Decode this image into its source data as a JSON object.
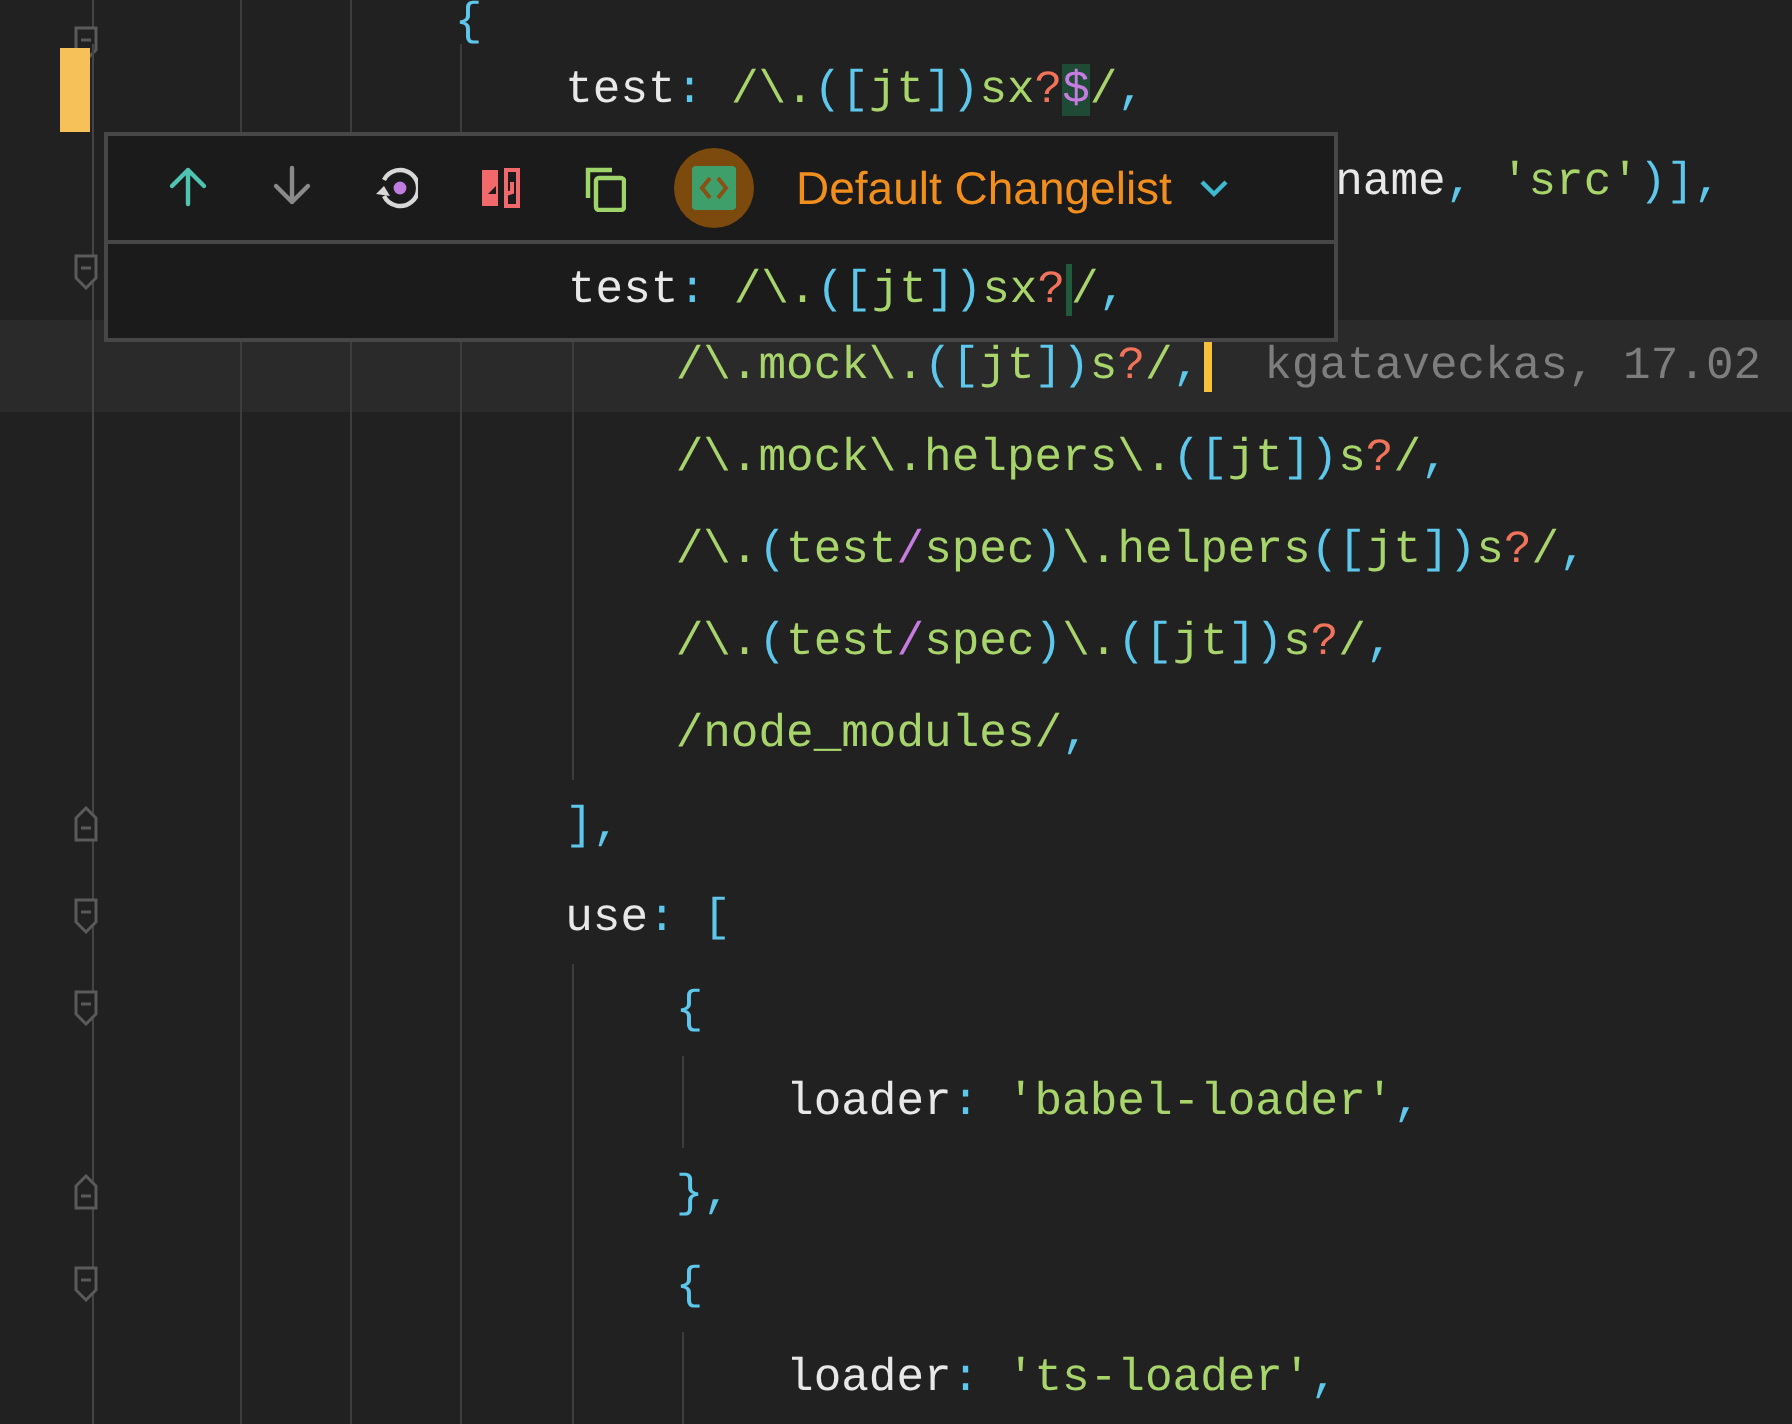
{
  "popup": {
    "buttons": [
      {
        "kind": "up",
        "disabled": false,
        "selected": false
      },
      {
        "kind": "down",
        "disabled": true,
        "selected": false
      },
      {
        "kind": "rollback",
        "disabled": false,
        "selected": false
      },
      {
        "kind": "diff",
        "disabled": false,
        "selected": false
      },
      {
        "kind": "copy",
        "disabled": false,
        "selected": false
      },
      {
        "kind": "code",
        "disabled": false,
        "selected": true
      }
    ],
    "changelist": "Default Changelist",
    "diff_line": [
      {
        "t": "test",
        "kind": "key"
      },
      {
        "t": ": ",
        "kind": "punct"
      },
      {
        "t": "/\\.",
        "kind": "re"
      },
      {
        "t": "([",
        "kind": "punct"
      },
      {
        "t": "jt",
        "kind": "re"
      },
      {
        "t": "])",
        "kind": "punct"
      },
      {
        "t": "sx",
        "kind": "re"
      },
      {
        "t": "?",
        "kind": "quant"
      },
      {
        "t": "/",
        "kind": "re",
        "marker": true
      },
      {
        "t": ",",
        "kind": "punct"
      }
    ]
  },
  "code": [
    {
      "kind": "code",
      "tokens": [
        {
          "t": "{",
          "kind": "punct"
        }
      ],
      "children": [
        {
          "kind": "code",
          "changed": true,
          "tokens": [
            {
              "t": "test",
              "kind": "key"
            },
            {
              "t": ": ",
              "kind": "punct"
            },
            {
              "t": "/\\.",
              "kind": "re"
            },
            {
              "t": "([",
              "kind": "punct"
            },
            {
              "t": "jt",
              "kind": "re"
            },
            {
              "t": "])",
              "kind": "punct"
            },
            {
              "t": "sx",
              "kind": "re"
            },
            {
              "t": "?",
              "kind": "quant"
            },
            {
              "t": "$",
              "kind": "alt",
              "hl": true
            },
            {
              "t": "/",
              "kind": "re"
            },
            {
              "t": ",",
              "kind": "punct"
            }
          ]
        },
        {
          "kind": "partial",
          "tokens": [
            {
              "t": "name",
              "kind": "key"
            },
            {
              "t": ", ",
              "kind": "punct"
            },
            {
              "t": "'src'",
              "kind": "str"
            },
            {
              "t": ")],",
              "kind": "punct"
            }
          ]
        },
        {
          "kind": "covered",
          "children": [
            {
              "kind": "code",
              "current": true,
              "caret": true,
              "blame": "kgataveckas, 17.02",
              "tokens": [
                {
                  "t": "/\\.mock\\.",
                  "kind": "re"
                },
                {
                  "t": "([",
                  "kind": "punct"
                },
                {
                  "t": "jt",
                  "kind": "re"
                },
                {
                  "t": "])",
                  "kind": "punct"
                },
                {
                  "t": "s",
                  "kind": "re"
                },
                {
                  "t": "?",
                  "kind": "quant"
                },
                {
                  "t": "/",
                  "kind": "re"
                },
                {
                  "t": ",",
                  "kind": "punct"
                }
              ]
            },
            {
              "kind": "code",
              "tokens": [
                {
                  "t": "/\\.mock\\.helpers\\.",
                  "kind": "re"
                },
                {
                  "t": "([",
                  "kind": "punct"
                },
                {
                  "t": "jt",
                  "kind": "re"
                },
                {
                  "t": "])",
                  "kind": "punct"
                },
                {
                  "t": "s",
                  "kind": "re"
                },
                {
                  "t": "?",
                  "kind": "quant"
                },
                {
                  "t": "/",
                  "kind": "re"
                },
                {
                  "t": ",",
                  "kind": "punct"
                }
              ]
            },
            {
              "kind": "code",
              "tokens": [
                {
                  "t": "/\\.",
                  "kind": "re"
                },
                {
                  "t": "(",
                  "kind": "punct"
                },
                {
                  "t": "test",
                  "kind": "re"
                },
                {
                  "t": "/",
                  "kind": "alt"
                },
                {
                  "t": "spec",
                  "kind": "re"
                },
                {
                  "t": ")",
                  "kind": "punct"
                },
                {
                  "t": "\\.helpers",
                  "kind": "re"
                },
                {
                  "t": "([",
                  "kind": "punct"
                },
                {
                  "t": "jt",
                  "kind": "re"
                },
                {
                  "t": "])",
                  "kind": "punct"
                },
                {
                  "t": "s",
                  "kind": "re"
                },
                {
                  "t": "?",
                  "kind": "quant"
                },
                {
                  "t": "/",
                  "kind": "re"
                },
                {
                  "t": ",",
                  "kind": "punct"
                }
              ]
            },
            {
              "kind": "code",
              "tokens": [
                {
                  "t": "/\\.",
                  "kind": "re"
                },
                {
                  "t": "(",
                  "kind": "punct"
                },
                {
                  "t": "test",
                  "kind": "re"
                },
                {
                  "t": "/",
                  "kind": "alt"
                },
                {
                  "t": "spec",
                  "kind": "re"
                },
                {
                  "t": ")",
                  "kind": "punct"
                },
                {
                  "t": "\\.",
                  "kind": "re"
                },
                {
                  "t": "([",
                  "kind": "punct"
                },
                {
                  "t": "jt",
                  "kind": "re"
                },
                {
                  "t": "])",
                  "kind": "punct"
                },
                {
                  "t": "s",
                  "kind": "re"
                },
                {
                  "t": "?",
                  "kind": "quant"
                },
                {
                  "t": "/",
                  "kind": "re"
                },
                {
                  "t": ",",
                  "kind": "punct"
                }
              ]
            },
            {
              "kind": "code",
              "tokens": [
                {
                  "t": "/node_modules/",
                  "kind": "re"
                },
                {
                  "t": ",",
                  "kind": "punct"
                }
              ]
            }
          ]
        },
        {
          "kind": "code",
          "fold_end": true,
          "tokens": [
            {
              "t": "],",
              "kind": "punct"
            }
          ]
        },
        {
          "kind": "code",
          "tokens": [
            {
              "t": "use",
              "kind": "key"
            },
            {
              "t": ": [",
              "kind": "punct"
            }
          ],
          "children": [
            {
              "kind": "code",
              "tokens": [
                {
                  "t": "{",
                  "kind": "punct"
                }
              ],
              "children": [
                {
                  "kind": "code",
                  "tokens": [
                    {
                      "t": "loader",
                      "kind": "key"
                    },
                    {
                      "t": ": ",
                      "kind": "punct"
                    },
                    {
                      "t": "'babel-loader'",
                      "kind": "str"
                    },
                    {
                      "t": ",",
                      "kind": "punct"
                    }
                  ]
                }
              ]
            },
            {
              "kind": "code",
              "fold_end": true,
              "tokens": [
                {
                  "t": "},",
                  "kind": "punct"
                }
              ]
            },
            {
              "kind": "code",
              "tokens": [
                {
                  "t": "{",
                  "kind": "punct"
                }
              ],
              "children": [
                {
                  "kind": "code",
                  "tokens": [
                    {
                      "t": "loader",
                      "kind": "key"
                    },
                    {
                      "t": ": ",
                      "kind": "punct"
                    },
                    {
                      "t": "'ts-loader'",
                      "kind": "str"
                    },
                    {
                      "t": ",",
                      "kind": "punct"
                    }
                  ]
                }
              ]
            }
          ]
        }
      ]
    }
  ]
}
